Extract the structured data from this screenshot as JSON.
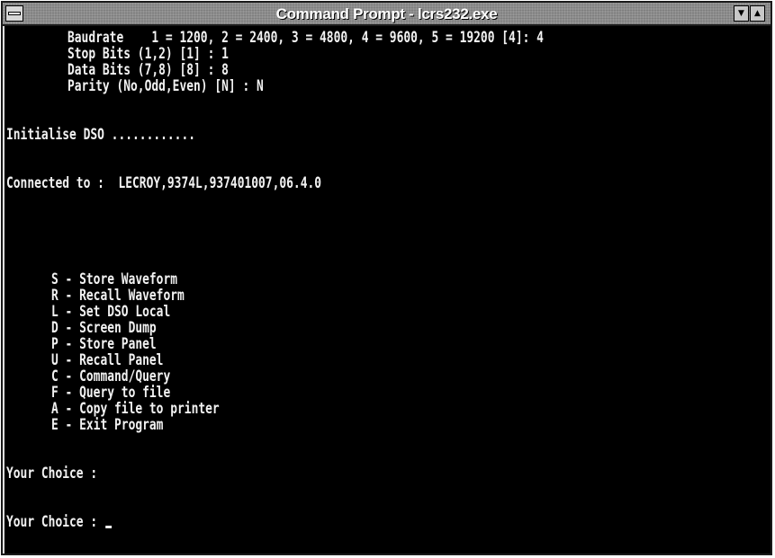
{
  "window": {
    "title": "Command Prompt - lcrs232.exe"
  },
  "console": {
    "settings": [
      "Baudrate    1 = 1200, 2 = 2400, 3 = 4800, 4 = 9600, 5 = 19200 [4]: 4",
      "Stop Bits (1,2) [1] : 1",
      "Data Bits (7,8) [8] : 8",
      "Parity (No,Odd,Even) [N] : N"
    ],
    "init_line": "Initialise DSO ............",
    "connected_line": "Connected to :  LECROY,9374L,937401007,06.4.0",
    "menu": [
      "S - Store Waveform",
      "R - Recall Waveform",
      "L - Set DSO Local",
      "D - Screen Dump",
      "P - Store Panel",
      "U - Recall Panel",
      "C - Command/Query",
      "F - Query to file",
      "A - Copy file to printer",
      "E - Exit Program"
    ],
    "prompt_previous": "Your Choice :",
    "prompt_current": "Your Choice : "
  },
  "icons": {
    "system_menu": "system-menu-icon",
    "minimize": "minimize-arrow-icon",
    "maximize": "maximize-arrow-icon",
    "cursor": "text-cursor-icon"
  },
  "colors": {
    "console_background": "#000000",
    "console_text": "#f2f2f2",
    "titlebar": "#8c8c8c"
  }
}
